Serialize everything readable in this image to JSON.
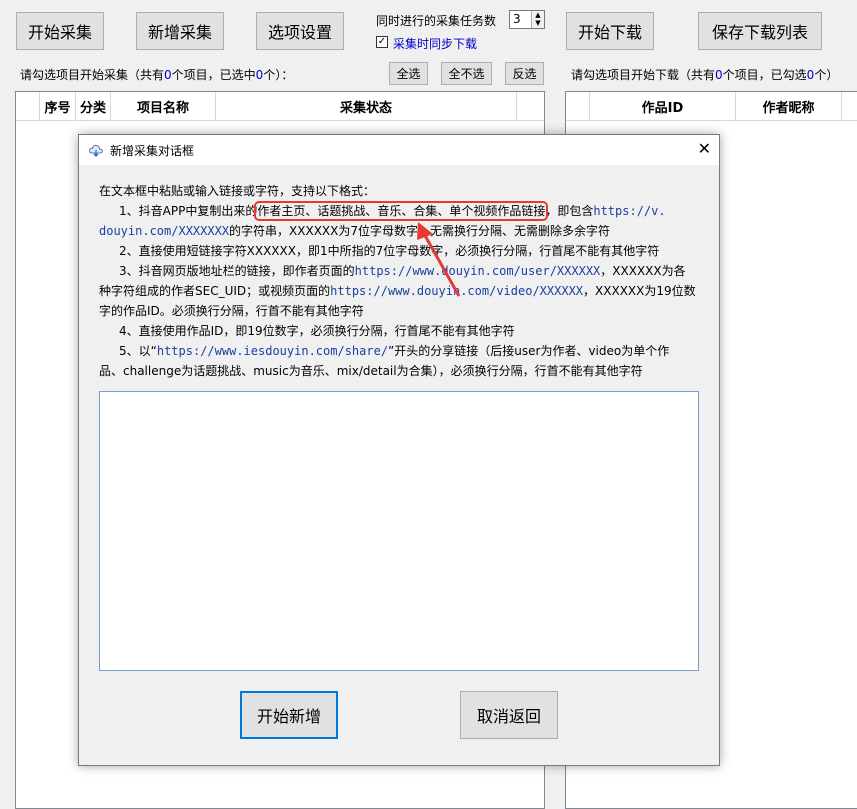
{
  "toolbar": {
    "start_collect": "开始采集",
    "add_collect": "新增采集",
    "options": "选项设置",
    "concurrent_label": "同时进行的采集任务数",
    "concurrent_value": "3",
    "sync_download_label": "采集时同步下载",
    "start_download": "开始下载",
    "save_download_list": "保存下载列表"
  },
  "left_panel": {
    "status_prefix": "请勾选项目开始采集（共有",
    "status_total": "0",
    "status_mid": "个项目，已选中",
    "status_selected": "0",
    "status_suffix": "个）：",
    "select_all": "全选",
    "select_none": "全不选",
    "invert": "反选",
    "columns": [
      "序号",
      "分类",
      "项目名称",
      "采集状态"
    ]
  },
  "right_panel": {
    "status_prefix": "请勾选项目开始下载（共有",
    "status_total": "0",
    "status_mid": "个项目，已勾选",
    "status_selected": "0",
    "status_suffix": "个）",
    "columns": [
      "作品ID",
      "作者昵称"
    ]
  },
  "dialog": {
    "title": "新增采集对话框",
    "intro": "在文本框中粘贴或输入链接或字符，支持以下格式：",
    "item1_a": "1、抖音APP中复制出来的",
    "item1_highlight": "作者主页、话题挑战、音乐、合集、单个视频作品链接",
    "item1_b": "，即包含",
    "item1_link1": "https://v.",
    "item1_link2": "douyin.com/XXXXXXX",
    "item1_c": "的字符串，XXXXXX为7位字母数字，无需换行分隔、无需删除多余字符",
    "item2": "2、直接使用短链接字符XXXXXX，即1中所指的7位字母数字，必须换行分隔，行首尾不能有其他字符",
    "item3_a": "3、抖音网页版地址栏的链接，即作者页面的",
    "item3_link1": "https://www.douyin.com/user/XXXXXX",
    "item3_b": "，XXXXXX为各",
    "item3_c": "种字符组成的作者SEC_UID；或视频页面的",
    "item3_link2": "https://www.douyin.com/video/XXXXXX",
    "item3_d": "，XXXXXX为19位数",
    "item3_e": "字的作品ID。必须换行分隔，行首不能有其他字符",
    "item4": "4、直接使用作品ID，即19位数字，必须换行分隔，行首尾不能有其他字符",
    "item5_a": "5、以“",
    "item5_link": "https://www.iesdouyin.com/share/",
    "item5_b": "”开头的分享链接（后接user为作者、video为单个作",
    "item5_c": "品、challenge为话题挑战、music为音乐、mix/detail为合集），必须换行分隔，行首不能有其他字符",
    "input_value": "",
    "confirm": "开始新增",
    "cancel": "取消返回",
    "highlight_color": "#e53935",
    "arrow_color": "#e53935"
  }
}
